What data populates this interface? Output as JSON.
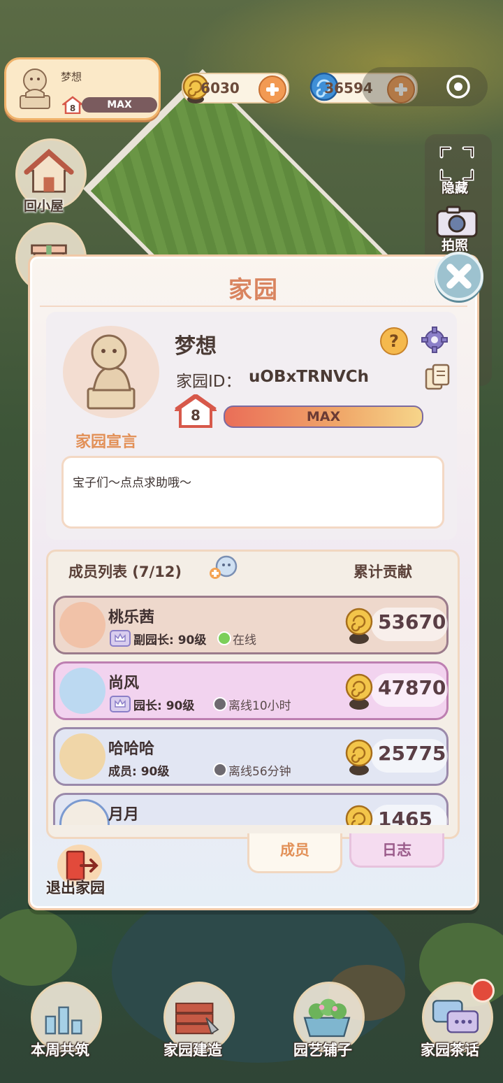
{
  "hud": {
    "player_name": "梦想",
    "player_level": "8",
    "player_level_bar": "MAX",
    "currency_snail": "6030",
    "currency_swirl": "36594"
  },
  "side": {
    "back_home": "回小屋",
    "hide": "隐藏",
    "photo": "拍照"
  },
  "dialog": {
    "title": "家园",
    "garden_name": "梦想",
    "garden_id_label": "家园ID：",
    "garden_id_value": "uOBxTRNVCh",
    "level": "8",
    "level_bar": "MAX",
    "manifesto_label": "家园宣言",
    "manifesto_text": "宝子们～点点求助哦～",
    "members_title": "成员列表 (7/12)",
    "contribution_title": "累计贡献",
    "members": [
      {
        "name": "桃乐茜",
        "role": "副园长: 90级",
        "status": "在线",
        "contribution": "53670",
        "online": true,
        "bg": "#eed8cc",
        "border": "#9b7b8b"
      },
      {
        "name": "尚风",
        "role": "园长: 90级",
        "status": "离线10小时",
        "contribution": "47870",
        "online": false,
        "bg": "#f2d3ef",
        "border": "#bd7fb1"
      },
      {
        "name": "哈哈哈",
        "role": "成员: 90级",
        "status": "离线56分钟",
        "contribution": "25775",
        "online": false,
        "bg": "#e2e6f3",
        "border": "#9a89aa"
      },
      {
        "name": "月月",
        "role": "",
        "status": "",
        "contribution": "1465",
        "online": false,
        "bg": "#e2e6f3",
        "border": "#9a89aa"
      }
    ],
    "tab_members": "成员",
    "tab_log": "日志",
    "exit_label": "退出家园"
  },
  "nav": {
    "weekly_build": "本周共筑",
    "garden_build": "家园建造",
    "garden_shop": "园艺铺子",
    "garden_chat": "家园茶话"
  },
  "colors": {
    "accent_orange": "#e29057",
    "title_orange": "#d9845f",
    "online_green": "#7ccf5a",
    "offline_gray": "#6e6a70"
  },
  "icons": [
    "lion-statue-avatar",
    "house-level-icon",
    "snail-coin-icon",
    "swirl-gem-icon",
    "plus-icon",
    "target-icon",
    "house-icon",
    "gift-icon",
    "frame-hide-icon",
    "camera-icon",
    "close-icon",
    "help-icon",
    "gear-icon",
    "copy-icon",
    "add-member-icon",
    "crown-badge-icon",
    "exit-door-icon",
    "trophy-chart-icon",
    "bricks-trowel-icon",
    "flower-pot-icon",
    "chat-bubbles-icon"
  ]
}
